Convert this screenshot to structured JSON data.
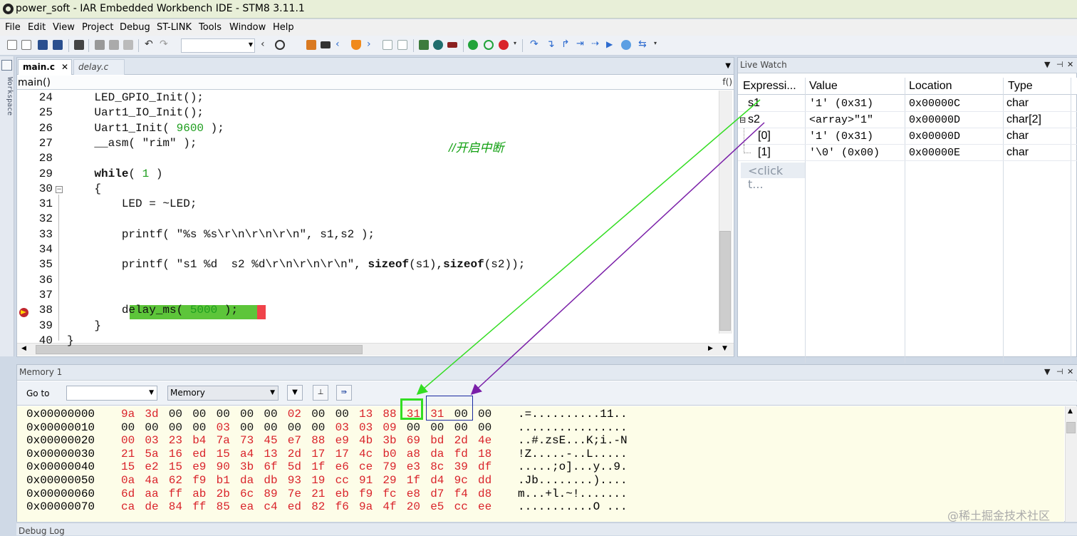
{
  "window": {
    "title": "power_soft - IAR Embedded Workbench IDE - STM8 3.11.1"
  },
  "menu": [
    "File",
    "Edit",
    "View",
    "Project",
    "Debug",
    "ST-LINK",
    "Tools",
    "Window",
    "Help"
  ],
  "workspace": {
    "label": "Workspace"
  },
  "editor": {
    "tabs": [
      {
        "label": "main.c",
        "active": true
      },
      {
        "label": "delay.c",
        "active": false
      }
    ],
    "close_glyph": "✕",
    "function": "main()",
    "func_button": "f()",
    "lines": [
      {
        "n": "24",
        "code": "    LED_GPIO_Init();"
      },
      {
        "n": "25",
        "code": "    Uart1_IO_Init();"
      },
      {
        "n": "26",
        "code": "    Uart1_Init( ",
        "num": "9600",
        "after": " );"
      },
      {
        "n": "27",
        "code": "    __asm( \"rim\" );",
        "comment": "//开启中断"
      },
      {
        "n": "28",
        "code": ""
      },
      {
        "n": "29",
        "kw": "    while",
        "code": "( ",
        "num": "1",
        "after": " )"
      },
      {
        "n": "30",
        "code": "    {"
      },
      {
        "n": "31",
        "code": "        LED = ~LED;"
      },
      {
        "n": "32",
        "code": ""
      },
      {
        "n": "33",
        "code": "        printf( \"%s %s\\r\\n\\r\\n\\r\\n\", s1,s2 );"
      },
      {
        "n": "34",
        "code": ""
      },
      {
        "n": "35",
        "code": "        printf( \"s1 %d  s2 %d\\r\\n\\r\\n\\r\\n\", ",
        "kw2": "sizeof",
        "code2": "(s1),",
        "kw3": "sizeof",
        "code3": "(s2));"
      },
      {
        "n": "36",
        "code": ""
      },
      {
        "n": "37",
        "code": ""
      },
      {
        "n": "38",
        "code": "        delay_ms( ",
        "num": "5000",
        "after": " );",
        "current": true
      },
      {
        "n": "39",
        "code": "    }"
      },
      {
        "n": "40",
        "code": "}"
      }
    ]
  },
  "live_watch": {
    "title": "Live Watch",
    "columns": [
      "Expressi...",
      "Value",
      "Location",
      "Type"
    ],
    "rows": [
      {
        "expr": "s1",
        "value": "'1' (0x31)",
        "location": "0x00000C",
        "type": "char"
      },
      {
        "expr": "s2",
        "value": "<array>\"1\"",
        "location": "0x00000D",
        "type": "char[2]",
        "expander": "⊟"
      },
      {
        "expr": "[0]",
        "value": "'1' (0x31)",
        "location": "0x00000D",
        "type": "char"
      },
      {
        "expr": "[1]",
        "value": "'\\0' (0x00)",
        "location": "0x00000E",
        "type": "char"
      }
    ],
    "add_placeholder": "<click t..."
  },
  "memory": {
    "title": "Memory 1",
    "goto_label": "Go to",
    "zone": "Memory",
    "rows": [
      {
        "addr": "0x00000000",
        "bytes": [
          "9a",
          "3d",
          "00",
          "00",
          "00",
          "00",
          "00",
          "02",
          "00",
          "00",
          "13",
          "88",
          "31",
          "31",
          "00",
          "00"
        ],
        "red": [
          1,
          1,
          0,
          0,
          0,
          0,
          0,
          1,
          0,
          0,
          1,
          1,
          1,
          1,
          0,
          0
        ],
        "ascii": ".=..........11.."
      },
      {
        "addr": "0x00000010",
        "bytes": [
          "00",
          "00",
          "00",
          "00",
          "03",
          "00",
          "00",
          "00",
          "00",
          "03",
          "03",
          "09",
          "00",
          "00",
          "00",
          "00"
        ],
        "red": [
          0,
          0,
          0,
          0,
          1,
          0,
          0,
          0,
          0,
          1,
          1,
          1,
          0,
          0,
          0,
          0
        ],
        "ascii": "................"
      },
      {
        "addr": "0x00000020",
        "bytes": [
          "00",
          "03",
          "23",
          "b4",
          "7a",
          "73",
          "45",
          "e7",
          "88",
          "e9",
          "4b",
          "3b",
          "69",
          "bd",
          "2d",
          "4e"
        ],
        "red": [
          1,
          1,
          1,
          1,
          1,
          1,
          1,
          1,
          1,
          1,
          1,
          1,
          1,
          1,
          1,
          1
        ],
        "ascii": "..#.zsE...K;i.-N"
      },
      {
        "addr": "0x00000030",
        "bytes": [
          "21",
          "5a",
          "16",
          "ed",
          "15",
          "a4",
          "13",
          "2d",
          "17",
          "17",
          "4c",
          "b0",
          "a8",
          "da",
          "fd",
          "18"
        ],
        "red": [
          1,
          1,
          1,
          1,
          1,
          1,
          1,
          1,
          1,
          1,
          1,
          1,
          1,
          1,
          1,
          1
        ],
        "ascii": "!Z.....-..L....."
      },
      {
        "addr": "0x00000040",
        "bytes": [
          "15",
          "e2",
          "15",
          "e9",
          "90",
          "3b",
          "6f",
          "5d",
          "1f",
          "e6",
          "ce",
          "79",
          "e3",
          "8c",
          "39",
          "df"
        ],
        "red": [
          1,
          1,
          1,
          1,
          1,
          1,
          1,
          1,
          1,
          1,
          1,
          1,
          1,
          1,
          1,
          1
        ],
        "ascii": ".....;o]...y..9."
      },
      {
        "addr": "0x00000050",
        "bytes": [
          "0a",
          "4a",
          "62",
          "f9",
          "b1",
          "da",
          "db",
          "93",
          "19",
          "cc",
          "91",
          "29",
          "1f",
          "d4",
          "9c",
          "dd"
        ],
        "red": [
          1,
          1,
          1,
          1,
          1,
          1,
          1,
          1,
          1,
          1,
          1,
          1,
          1,
          1,
          1,
          1
        ],
        "ascii": ".Jb........)...."
      },
      {
        "addr": "0x00000060",
        "bytes": [
          "6d",
          "aa",
          "ff",
          "ab",
          "2b",
          "6c",
          "89",
          "7e",
          "21",
          "eb",
          "f9",
          "fc",
          "e8",
          "d7",
          "f4",
          "d8"
        ],
        "red": [
          1,
          1,
          1,
          1,
          1,
          1,
          1,
          1,
          1,
          1,
          1,
          1,
          1,
          1,
          1,
          1
        ],
        "ascii": "m...+l.~!......."
      },
      {
        "addr": "0x00000070",
        "bytes": [
          "ca",
          "de",
          "84",
          "ff",
          "85",
          "ea",
          "c4",
          "ed",
          "82",
          "f6",
          "9a",
          "4f",
          "20",
          "e5",
          "cc",
          "ee"
        ],
        "red": [
          1,
          1,
          1,
          1,
          1,
          1,
          1,
          1,
          1,
          1,
          1,
          1,
          1,
          1,
          1,
          1
        ],
        "ascii": "...........O ..."
      }
    ]
  },
  "debug_log": {
    "title": "Debug Log"
  },
  "watermark": "@稀土掘金技术社区",
  "colors": {
    "current_line": "#5dc53a",
    "breakpoint": "#c1272d",
    "mem_changed": "#d9232a",
    "green_arrow": "#33dd22",
    "purple_arrow": "#7a1fa8"
  },
  "toolbar_icons": [
    "new-file-icon",
    "new-project-icon",
    "save-icon",
    "save-all-icon",
    "print-icon",
    "cut-icon",
    "copy-icon",
    "paste-icon",
    "undo-icon",
    "redo-icon",
    "nav-back-icon",
    "find-icon",
    "toggle-bookmark-icon",
    "goto-bookmark-icon",
    "prev-icon",
    "shield-icon",
    "next-icon",
    "compile-icon",
    "make-icon",
    "debug-icon",
    "run-green-icon",
    "reset-icon",
    "stop-icon",
    "step-over-icon",
    "step-into-icon",
    "step-out-icon",
    "next-statement-icon",
    "run-to-cursor-icon",
    "go-icon",
    "break-icon",
    "more-icon"
  ]
}
